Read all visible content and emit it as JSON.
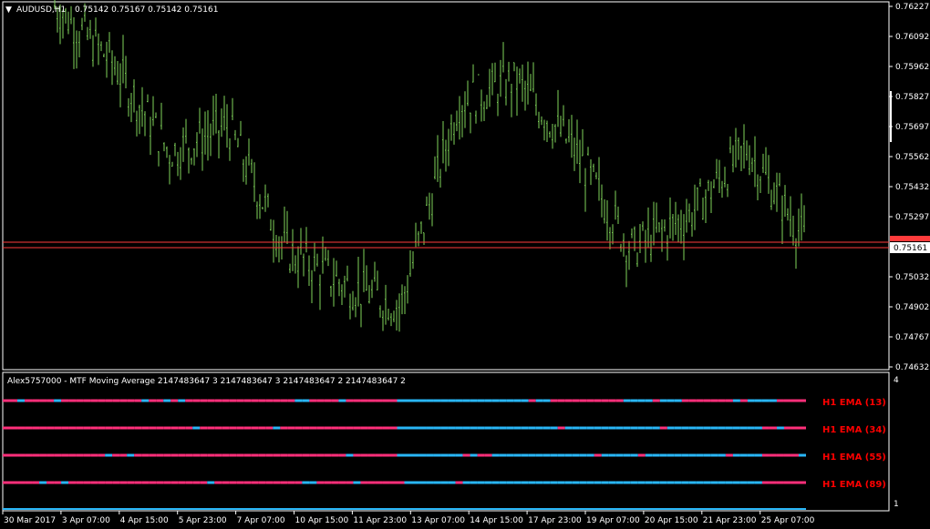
{
  "symbol": {
    "title": "AUDUSD,H1",
    "ohlc": "0.75142 0.75167 0.75142 0.75161"
  },
  "price_axis": {
    "ticks": [
      "0.76227",
      "0.76092",
      "0.75962",
      "0.75827",
      "0.75697",
      "0.75562",
      "0.75432",
      "0.75297",
      "0.75161",
      "0.75032",
      "0.74902",
      "0.74767",
      "0.74632"
    ],
    "current_price": "0.75161",
    "min": 0.74632,
    "max": 0.76227
  },
  "indicator": {
    "title": "Alex5757000 - MTF Moving Average 2147483647 3 2147483647 3 2147483647 2 2147483647 2",
    "scale_top": "4",
    "scale_bottom": "1",
    "lines": [
      {
        "label": "H1 EMA (13)"
      },
      {
        "label": "H1 EMA (34)"
      },
      {
        "label": "H1 EMA (55)"
      },
      {
        "label": "H1 EMA (89)"
      }
    ]
  },
  "time_axis": {
    "labels": [
      "30 Mar 2017",
      "3 Apr 07:00",
      "4 Apr 15:00",
      "5 Apr 23:00",
      "7 Apr 07:00",
      "10 Apr 15:00",
      "11 Apr 23:00",
      "13 Apr 07:00",
      "14 Apr 15:00",
      "17 Apr 23:00",
      "19 Apr 07:00",
      "20 Apr 15:00",
      "21 Apr 23:00",
      "25 Apr 07:00"
    ]
  },
  "colors": {
    "background": "#000000",
    "candles": "#7fd35a",
    "grid": "#ffffff",
    "up_segment": "#29b6f6",
    "down_segment": "#ff2f7a",
    "ema_label": "#ff0000",
    "price_line": "#ff3b3b"
  },
  "chart_data": {
    "type": "line",
    "title": "AUDUSD,H1",
    "series": [
      {
        "name": "AUDUSD,H1",
        "x": [
          "30 Mar 2017",
          "3 Apr 07:00",
          "4 Apr 15:00",
          "5 Apr 23:00",
          "7 Apr 07:00",
          "10 Apr 15:00",
          "11 Apr 23:00",
          "13 Apr 07:00",
          "14 Apr 15:00",
          "17 Apr 23:00",
          "19 Apr 07:00",
          "20 Apr 15:00",
          "21 Apr 23:00",
          "25 Apr 07:00"
        ],
        "values": [
          0.7623,
          0.7598,
          0.7558,
          0.757,
          0.7515,
          0.75,
          0.749,
          0.758,
          0.759,
          0.756,
          0.7515,
          0.753,
          0.756,
          0.752
        ]
      }
    ],
    "ylim": [
      0.74632,
      0.76227
    ],
    "xlabel": "",
    "ylabel": ""
  }
}
